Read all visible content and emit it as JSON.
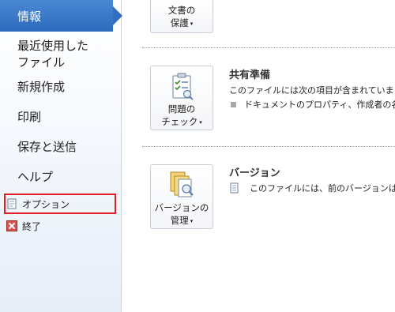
{
  "nav": {
    "active_label": "情報",
    "items": [
      {
        "label": "最近使用した\nファイル"
      },
      {
        "label": "新規作成"
      },
      {
        "label": "印刷"
      },
      {
        "label": "保存と送信"
      },
      {
        "label": "ヘルプ"
      }
    ],
    "options_label": "オプション",
    "exit_label": "終了"
  },
  "main": {
    "protect_button": {
      "line1": "文書の",
      "line2": "保護",
      "caret": "▾"
    },
    "inspect_button": {
      "line1": "問題の",
      "line2": "チェック",
      "caret": "▾"
    },
    "versions_button": {
      "line1": "バージョンの",
      "line2": "管理",
      "caret": "▾"
    },
    "prepare": {
      "title": "共有準備",
      "text": "このファイルには次の項目が含まれていま",
      "bullet": "ドキュメントのプロパティ、作成者の名"
    },
    "versions": {
      "title": "バージョン",
      "text": "このファイルには、前のバージョンはあ"
    }
  },
  "colors": {
    "active_nav": "#2d6bbd",
    "highlight": "#e31b23"
  }
}
